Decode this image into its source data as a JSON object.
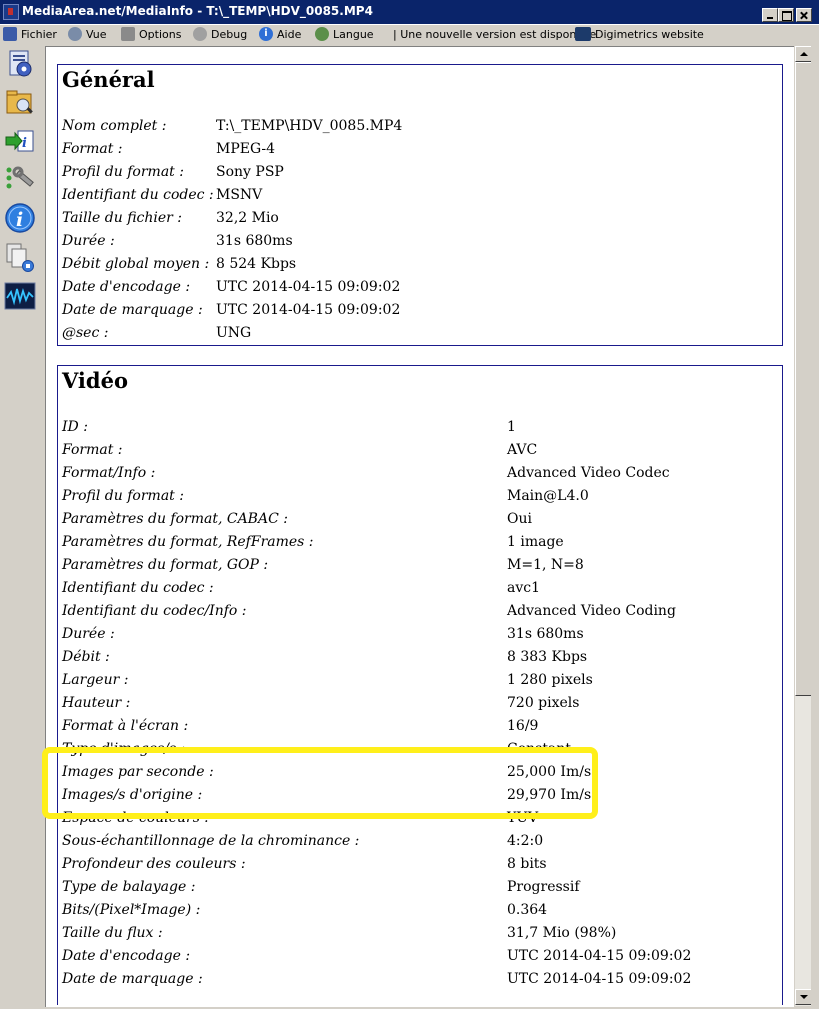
{
  "window": {
    "title": "MediaArea.net/MediaInfo - T:\\_TEMP\\HDV_0085.MP4"
  },
  "menu": {
    "fichier": "Fichier",
    "vue": "Vue",
    "options": "Options",
    "debug": "Debug",
    "aide": "Aide",
    "langue": "Langue",
    "new_version": "| Une nouvelle version est disponible",
    "digimetrics": "Digimetrics website"
  },
  "icons": {
    "menu_fichier": "open-file-icon",
    "menu_vue": "view-icon",
    "menu_options": "options-icon",
    "menu_debug": "debug-icon",
    "menu_aide": "help-icon",
    "menu_langue": "globe-icon",
    "menu_digimetrics": "digimetrics-icon",
    "toolbar": [
      "open-file-icon",
      "open-folder-icon",
      "export-icon",
      "preferences-icon",
      "info-icon",
      "compare-icon",
      "waveform-icon"
    ]
  },
  "general": {
    "title": "Général",
    "rows": [
      {
        "label": "Nom complet :",
        "value": "T:\\_TEMP\\HDV_0085.MP4"
      },
      {
        "label": "Format :",
        "value": "MPEG-4"
      },
      {
        "label": "Profil du format :",
        "value": "Sony PSP"
      },
      {
        "label": "Identifiant du codec :",
        "value": "MSNV"
      },
      {
        "label": "Taille du fichier :",
        "value": "32,2 Mio"
      },
      {
        "label": "Durée :",
        "value": "31s 680ms"
      },
      {
        "label": "Débit global moyen :",
        "value": "8 524 Kbps"
      },
      {
        "label": "Date d'encodage :",
        "value": "UTC 2014-04-15 09:09:02"
      },
      {
        "label": "Date de marquage :",
        "value": "UTC 2014-04-15 09:09:02"
      },
      {
        "label": "@sec :",
        "value": "UNG"
      }
    ]
  },
  "video": {
    "title": "Vidéo",
    "rows": [
      {
        "label": "ID :",
        "value": "1"
      },
      {
        "label": "Format :",
        "value": "AVC"
      },
      {
        "label": "Format/Info :",
        "value": "Advanced Video Codec"
      },
      {
        "label": "Profil du format :",
        "value": "Main@L4.0"
      },
      {
        "label": "Paramètres du format, CABAC :",
        "value": "Oui"
      },
      {
        "label": "Paramètres du format, RefFrames :",
        "value": "1 image"
      },
      {
        "label": "Paramètres du format, GOP :",
        "value": "M=1, N=8"
      },
      {
        "label": "Identifiant du codec :",
        "value": "avc1"
      },
      {
        "label": "Identifiant du codec/Info :",
        "value": "Advanced Video Coding"
      },
      {
        "label": "Durée :",
        "value": "31s 680ms"
      },
      {
        "label": "Débit :",
        "value": "8 383 Kbps"
      },
      {
        "label": "Largeur :",
        "value": "1 280 pixels"
      },
      {
        "label": "Hauteur :",
        "value": "720 pixels"
      },
      {
        "label": "Format à l'écran :",
        "value": "16/9"
      },
      {
        "label": "Type d'images/s :",
        "value": "Constant"
      },
      {
        "label": "Images par seconde :",
        "value": "25,000 Im/s"
      },
      {
        "label": "Images/s d'origine :",
        "value": "29,970 Im/s"
      },
      {
        "label": "Espace de couleurs :",
        "value": "YUV"
      },
      {
        "label": "Sous-échantillonnage de la chrominance :",
        "value": "4:2:0"
      },
      {
        "label": "Profondeur des couleurs :",
        "value": "8 bits"
      },
      {
        "label": "Type de balayage :",
        "value": "Progressif"
      },
      {
        "label": "Bits/(Pixel*Image) :",
        "value": "0.364"
      },
      {
        "label": "Taille du flux :",
        "value": "31,7 Mio (98%)"
      },
      {
        "label": "Date d'encodage :",
        "value": "UTC 2014-04-15 09:09:02"
      },
      {
        "label": "Date de marquage :",
        "value": "UTC 2014-04-15 09:09:02"
      }
    ]
  },
  "highlight_color": "#ffef1a",
  "titlebar_color": "#0a246a",
  "section_border_color": "#1a1a8c"
}
